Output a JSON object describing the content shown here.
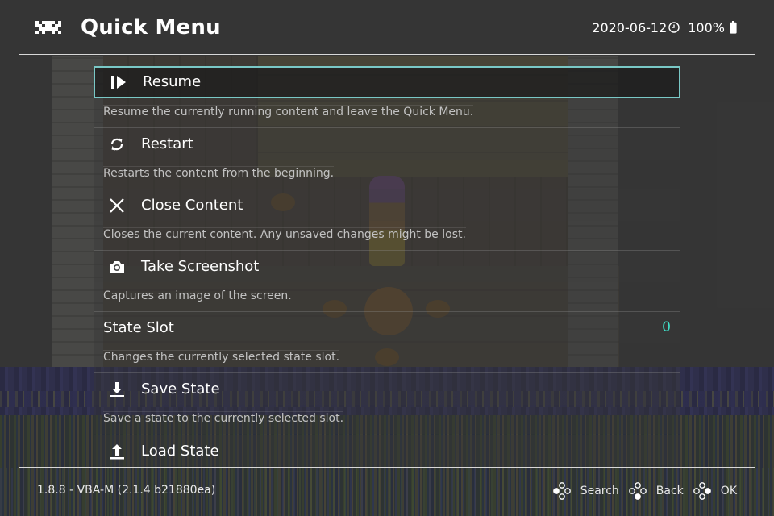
{
  "header": {
    "title": "Quick Menu",
    "date": "2020-06-12",
    "battery": "100%",
    "icons": [
      "retroarch-invader-logo",
      "clock-icon",
      "battery-icon"
    ]
  },
  "menu": {
    "items": [
      {
        "label": "Resume",
        "icon": "play-pause-icon",
        "description": "Resume the currently running content and leave the Quick Menu.",
        "selected": true
      },
      {
        "label": "Restart",
        "icon": "restart-icon",
        "description": "Restarts the content from the beginning."
      },
      {
        "label": "Close Content",
        "icon": "close-icon",
        "description": "Closes the current content. Any unsaved changes might be lost."
      },
      {
        "label": "Take Screenshot",
        "icon": "camera-icon",
        "description": "Captures an image of the screen."
      },
      {
        "label": "State Slot",
        "value": "0",
        "description": "Changes the currently selected state slot."
      },
      {
        "label": "Save State",
        "icon": "download-icon",
        "description": "Save a state to the currently selected slot."
      },
      {
        "label": "Load State",
        "icon": "upload-icon"
      }
    ]
  },
  "footer": {
    "version": "1.8.8 - VBA-M (2.1.4 b21880ea)",
    "hints": [
      {
        "label": "Search",
        "icon": "gamepad-buttons-icon"
      },
      {
        "label": "Back",
        "icon": "gamepad-buttons-icon"
      },
      {
        "label": "OK",
        "icon": "gamepad-buttons-icon"
      }
    ]
  },
  "colors": {
    "selection_border": "#79c8c6",
    "value_text": "#3fe0c8",
    "description_text": "#c2c2c2"
  }
}
